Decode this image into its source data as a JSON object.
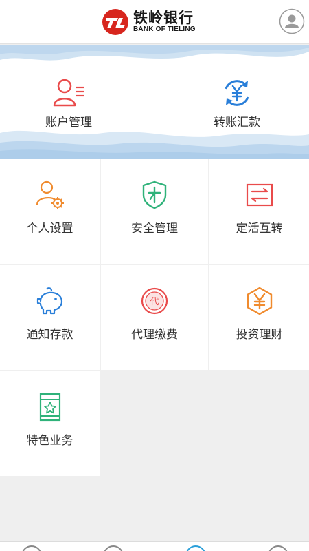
{
  "header": {
    "brand_cn": "铁岭银行",
    "brand_en": "BANK OF TIELING",
    "logo_icon": "bank-of-tieling-logo",
    "profile_icon": "user-profile-icon"
  },
  "banner": {
    "items": [
      {
        "label": "账户管理",
        "icon": "account-management-icon",
        "color": "#e94b4b"
      },
      {
        "label": "转账汇款",
        "icon": "transfer-remittance-icon",
        "color": "#2a7fd9"
      }
    ]
  },
  "services": [
    {
      "label": "个人设置",
      "icon": "personal-settings-icon",
      "color": "#f08b2e"
    },
    {
      "label": "安全管理",
      "icon": "security-shield-icon",
      "color": "#2fb27a"
    },
    {
      "label": "定活互转",
      "icon": "fixed-demand-transfer-icon",
      "color": "#e94b4b"
    },
    {
      "label": "通知存款",
      "icon": "piggy-bank-icon",
      "color": "#2a7fd9"
    },
    {
      "label": "代理缴费",
      "icon": "agency-payment-icon",
      "color": "#e94b4b"
    },
    {
      "label": "投资理财",
      "icon": "investment-icon",
      "color": "#f08b2e"
    },
    {
      "label": "特色业务",
      "icon": "featured-business-icon",
      "color": "#2fb27a"
    }
  ],
  "colors": {
    "brand_red": "#d7261e",
    "wave_blue": "#c9dff0",
    "page_gray": "#efefef"
  },
  "bottom_nav_icons": [
    "nav-tab-1-icon",
    "nav-tab-2-icon",
    "nav-tab-3-icon",
    "nav-tab-4-icon"
  ]
}
